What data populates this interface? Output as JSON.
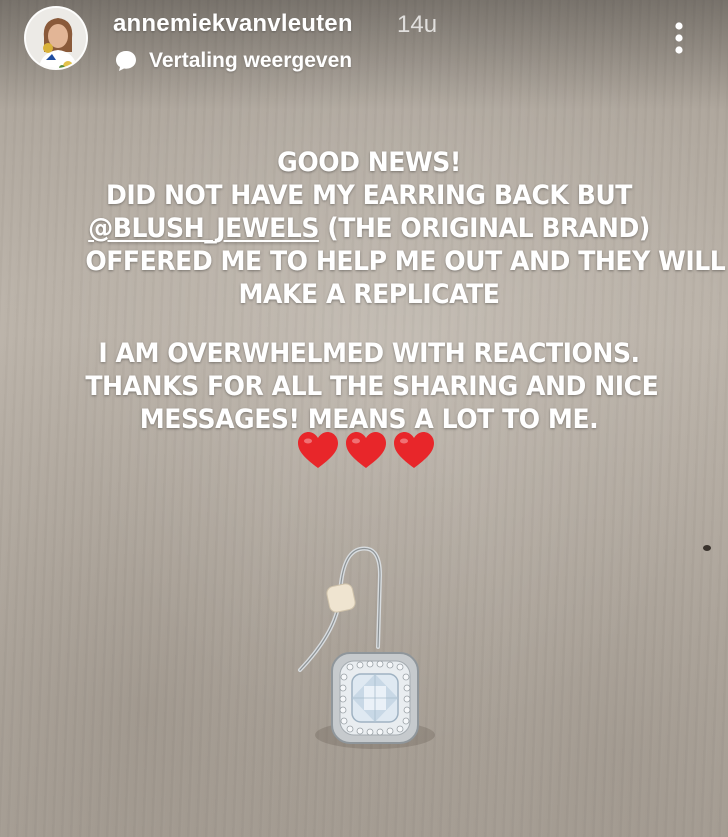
{
  "header": {
    "username": "annemiekvanvleuten",
    "timestamp": "14u",
    "translate_label": "Vertaling weergeven",
    "more_icon": "more-vertical-icon"
  },
  "story": {
    "lines_block1": [
      "GOOD NEWS!",
      "DID NOT HAVE MY EARRING BACK BUT",
      "@BLUSH_JEWELS",
      " (THE ORIGINAL BRAND)",
      "OFFERED ME TO HELP ME OUT AND THEY WILL",
      "MAKE A REPLICATE"
    ],
    "lines_block2": [
      "I AM OVERWHELMED WITH REACTIONS.",
      "THANKS FOR ALL THE SHARING AND NICE",
      "MESSAGES! MEANS A LOT TO ME."
    ],
    "hearts_count": 3,
    "heart_color": "#e8262a"
  },
  "colors": {
    "text": "#ffffff",
    "background": "#b2aaa0"
  }
}
